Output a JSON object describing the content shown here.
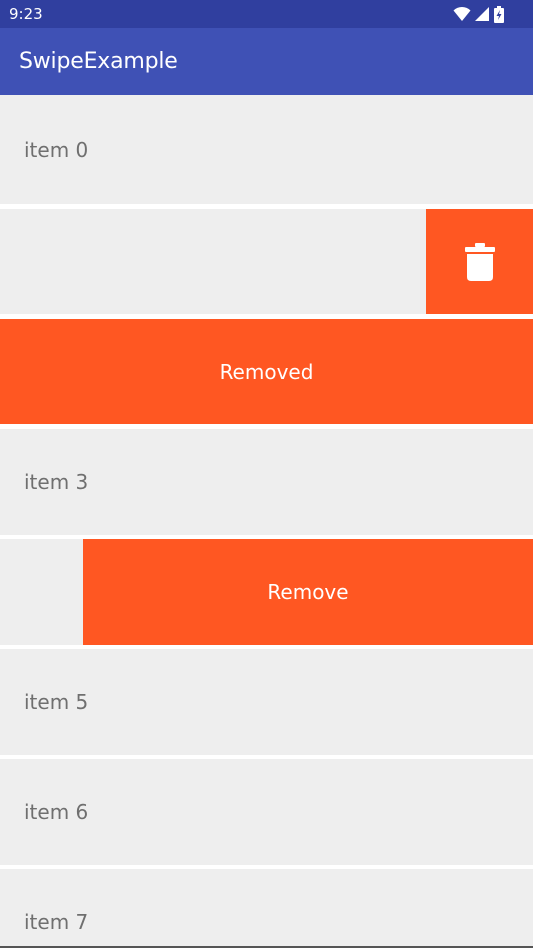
{
  "status_bar": {
    "time": "9:23"
  },
  "app_bar": {
    "title": "SwipeExample"
  },
  "list": {
    "items": [
      {
        "label": "item 0"
      },
      {
        "label": ""
      },
      {
        "label": "Removed"
      },
      {
        "label": "item 3"
      },
      {
        "label": "Remove"
      },
      {
        "label": "item 5"
      },
      {
        "label": "item 6"
      },
      {
        "label": "item 7"
      }
    ]
  },
  "icons": {
    "wifi": "wifi-icon",
    "signal": "signal-icon",
    "battery": "battery-icon",
    "delete": "trash-icon"
  },
  "colors": {
    "status_bar": "#303F9F",
    "app_bar": "#3F51B5",
    "accent": "#FF5722",
    "row": "#EEEEEE"
  }
}
